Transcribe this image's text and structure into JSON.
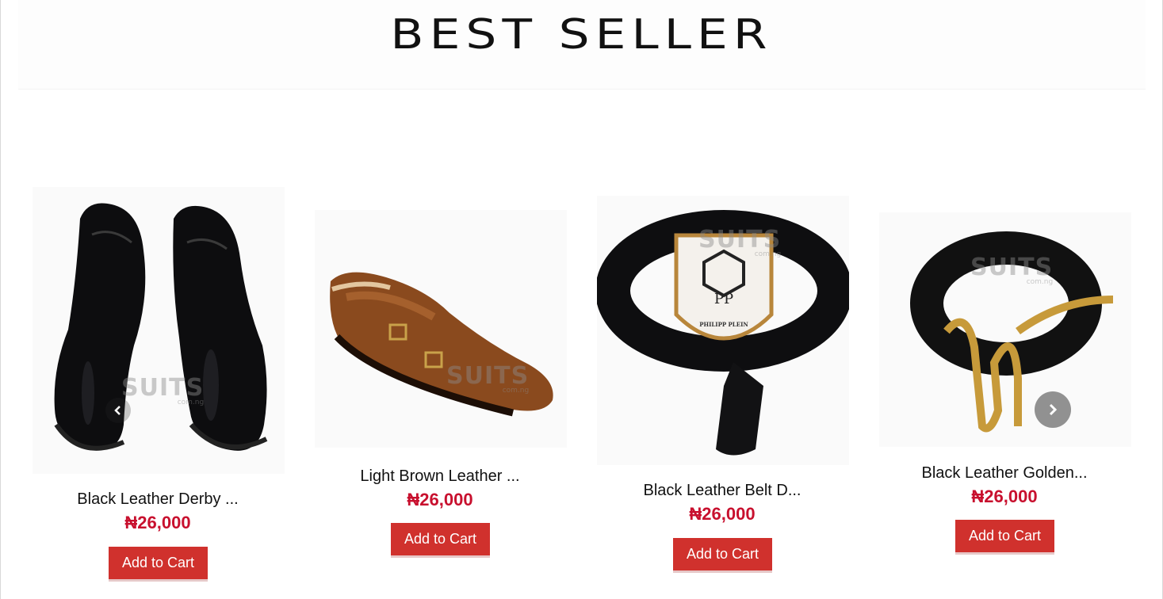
{
  "section": {
    "title": "BEST SELLER"
  },
  "products": [
    {
      "name": "Black Leather Derby ...",
      "price": "₦26,000",
      "button": "Add to Cart",
      "watermark": "SUITS",
      "watermark_sub": "com.ng"
    },
    {
      "name": "Light Brown Leather ...",
      "price": "₦26,000",
      "button": "Add to Cart",
      "watermark": "SUITS",
      "watermark_sub": "com.ng"
    },
    {
      "name": "Black Leather Belt D...",
      "price": "₦26,000",
      "button": "Add to Cart",
      "watermark": "SUITS",
      "watermark_sub": "com.ng",
      "badge_brand": "PHILIPP PLEIN",
      "badge_monogram": "PP"
    },
    {
      "name": "Black Leather Golden...",
      "price": "₦26,000",
      "button": "Add to Cart",
      "watermark": "SUITS",
      "watermark_sub": "com.ng"
    }
  ],
  "carousel": {
    "prev_icon": "chevron-left-icon",
    "next_icon": "chevron-right-icon"
  },
  "colors": {
    "accent": "#d0312d",
    "price": "#c8102e",
    "text": "#111111"
  }
}
